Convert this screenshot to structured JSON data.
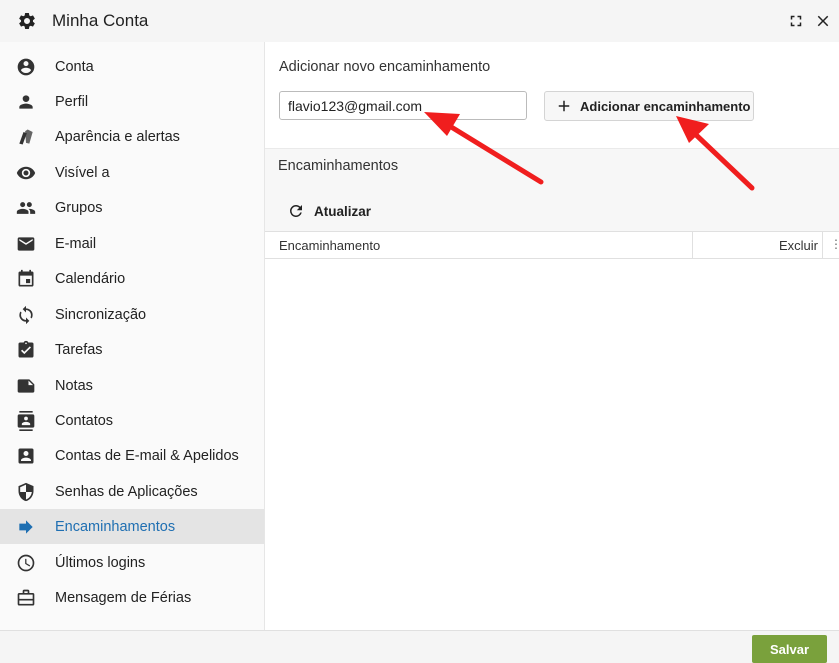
{
  "window": {
    "title": "Minha Conta",
    "title_icon": "gear-icon",
    "fullscreen_icon": "fullscreen-icon",
    "close_icon": "close-icon"
  },
  "sidebar": {
    "items": [
      {
        "label": "Conta",
        "icon": "account-circle-icon"
      },
      {
        "label": "Perfil",
        "icon": "person-icon"
      },
      {
        "label": "Aparência e alertas",
        "icon": "theme-icon"
      },
      {
        "label": "Visível a",
        "icon": "eye-icon"
      },
      {
        "label": "Grupos",
        "icon": "group-icon"
      },
      {
        "label": "E-mail",
        "icon": "mail-icon"
      },
      {
        "label": "Calendário",
        "icon": "calendar-icon"
      },
      {
        "label": "Sincronização",
        "icon": "sync-icon"
      },
      {
        "label": "Tarefas",
        "icon": "task-icon"
      },
      {
        "label": "Notas",
        "icon": "note-icon"
      },
      {
        "label": "Contatos",
        "icon": "contacts-icon"
      },
      {
        "label": "Contas de E-mail & Apelidos",
        "icon": "contact-card-icon"
      },
      {
        "label": "Senhas de Aplicações",
        "icon": "shield-icon"
      },
      {
        "label": "Encaminhamentos",
        "icon": "forward-arrow-icon",
        "active": true
      },
      {
        "label": "Últimos logins",
        "icon": "clock-icon"
      },
      {
        "label": "Mensagem de Férias",
        "icon": "briefcase-icon"
      }
    ]
  },
  "main": {
    "add_section_title": "Adicionar novo encaminhamento",
    "email_value": "flavio123@gmail.com",
    "add_button_label": "Adicionar encaminhamento",
    "add_button_icon": "plus-icon",
    "forwards_title": "Encaminhamentos",
    "refresh_label": "Atualizar",
    "refresh_icon": "refresh-icon",
    "grid": {
      "columns": [
        "Encaminhamento",
        "Excluir"
      ],
      "menu_glyph": "⋮",
      "rows": []
    }
  },
  "footer": {
    "save_label": "Salvar"
  },
  "colors": {
    "accent": "#1f6fb2",
    "save_button": "#7aa13c",
    "annotation_arrow": "#f01e1e"
  }
}
